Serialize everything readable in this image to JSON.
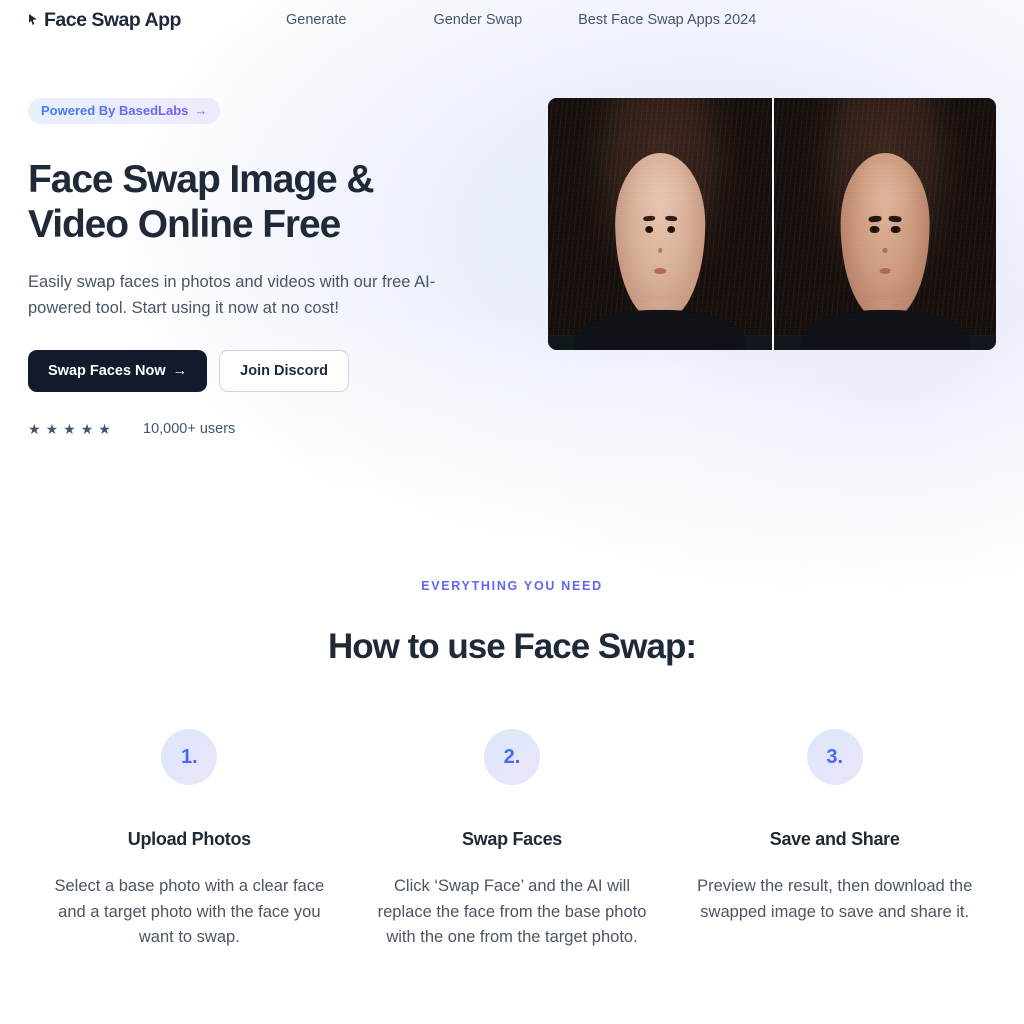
{
  "header": {
    "brand": {
      "mark_icon": "cursor-pointer-icon",
      "name": "Face Swap App"
    },
    "nav": [
      {
        "label": "Generate"
      },
      {
        "label": "Gender Swap"
      },
      {
        "label": "Best Face Swap Apps 2024"
      }
    ]
  },
  "hero": {
    "badge": {
      "label": "Powered By BasedLabs",
      "arrow": "→",
      "gradient_from": "#3b82f6",
      "gradient_to": "#7c5cf0"
    },
    "title": "Face Swap Image & Video Online Free",
    "subtitle": "Easily swap faces in photos and videos with our free AI-powered tool. Start using it now at no cost!",
    "primary_button": {
      "label": "Swap Faces Now",
      "arrow": "→",
      "bg": "#121a2b"
    },
    "secondary_button": {
      "label": "Join Discord"
    },
    "rating": {
      "star": "★",
      "star_count": 5,
      "users_label": "10,000+ users"
    },
    "compare_image": {
      "left_alt": "before-face-photo",
      "right_alt": "after-face-swapped-photo"
    }
  },
  "features": {
    "eyebrow": "EVERYTHING YOU NEED",
    "title": "How to use Face Swap:",
    "accent_color": "#6366f1",
    "steps": [
      {
        "number": "1.",
        "title": "Upload Photos",
        "desc": "Select a base photo with a clear face and a target photo with the face you want to swap."
      },
      {
        "number": "2.",
        "title": "Swap Faces",
        "desc": "Click ‘Swap Face’ and the AI will replace the face from the base photo with the one from the target photo."
      },
      {
        "number": "3.",
        "title": "Save and Share",
        "desc": "Preview the result, then download the swapped image to save and share it."
      }
    ]
  }
}
